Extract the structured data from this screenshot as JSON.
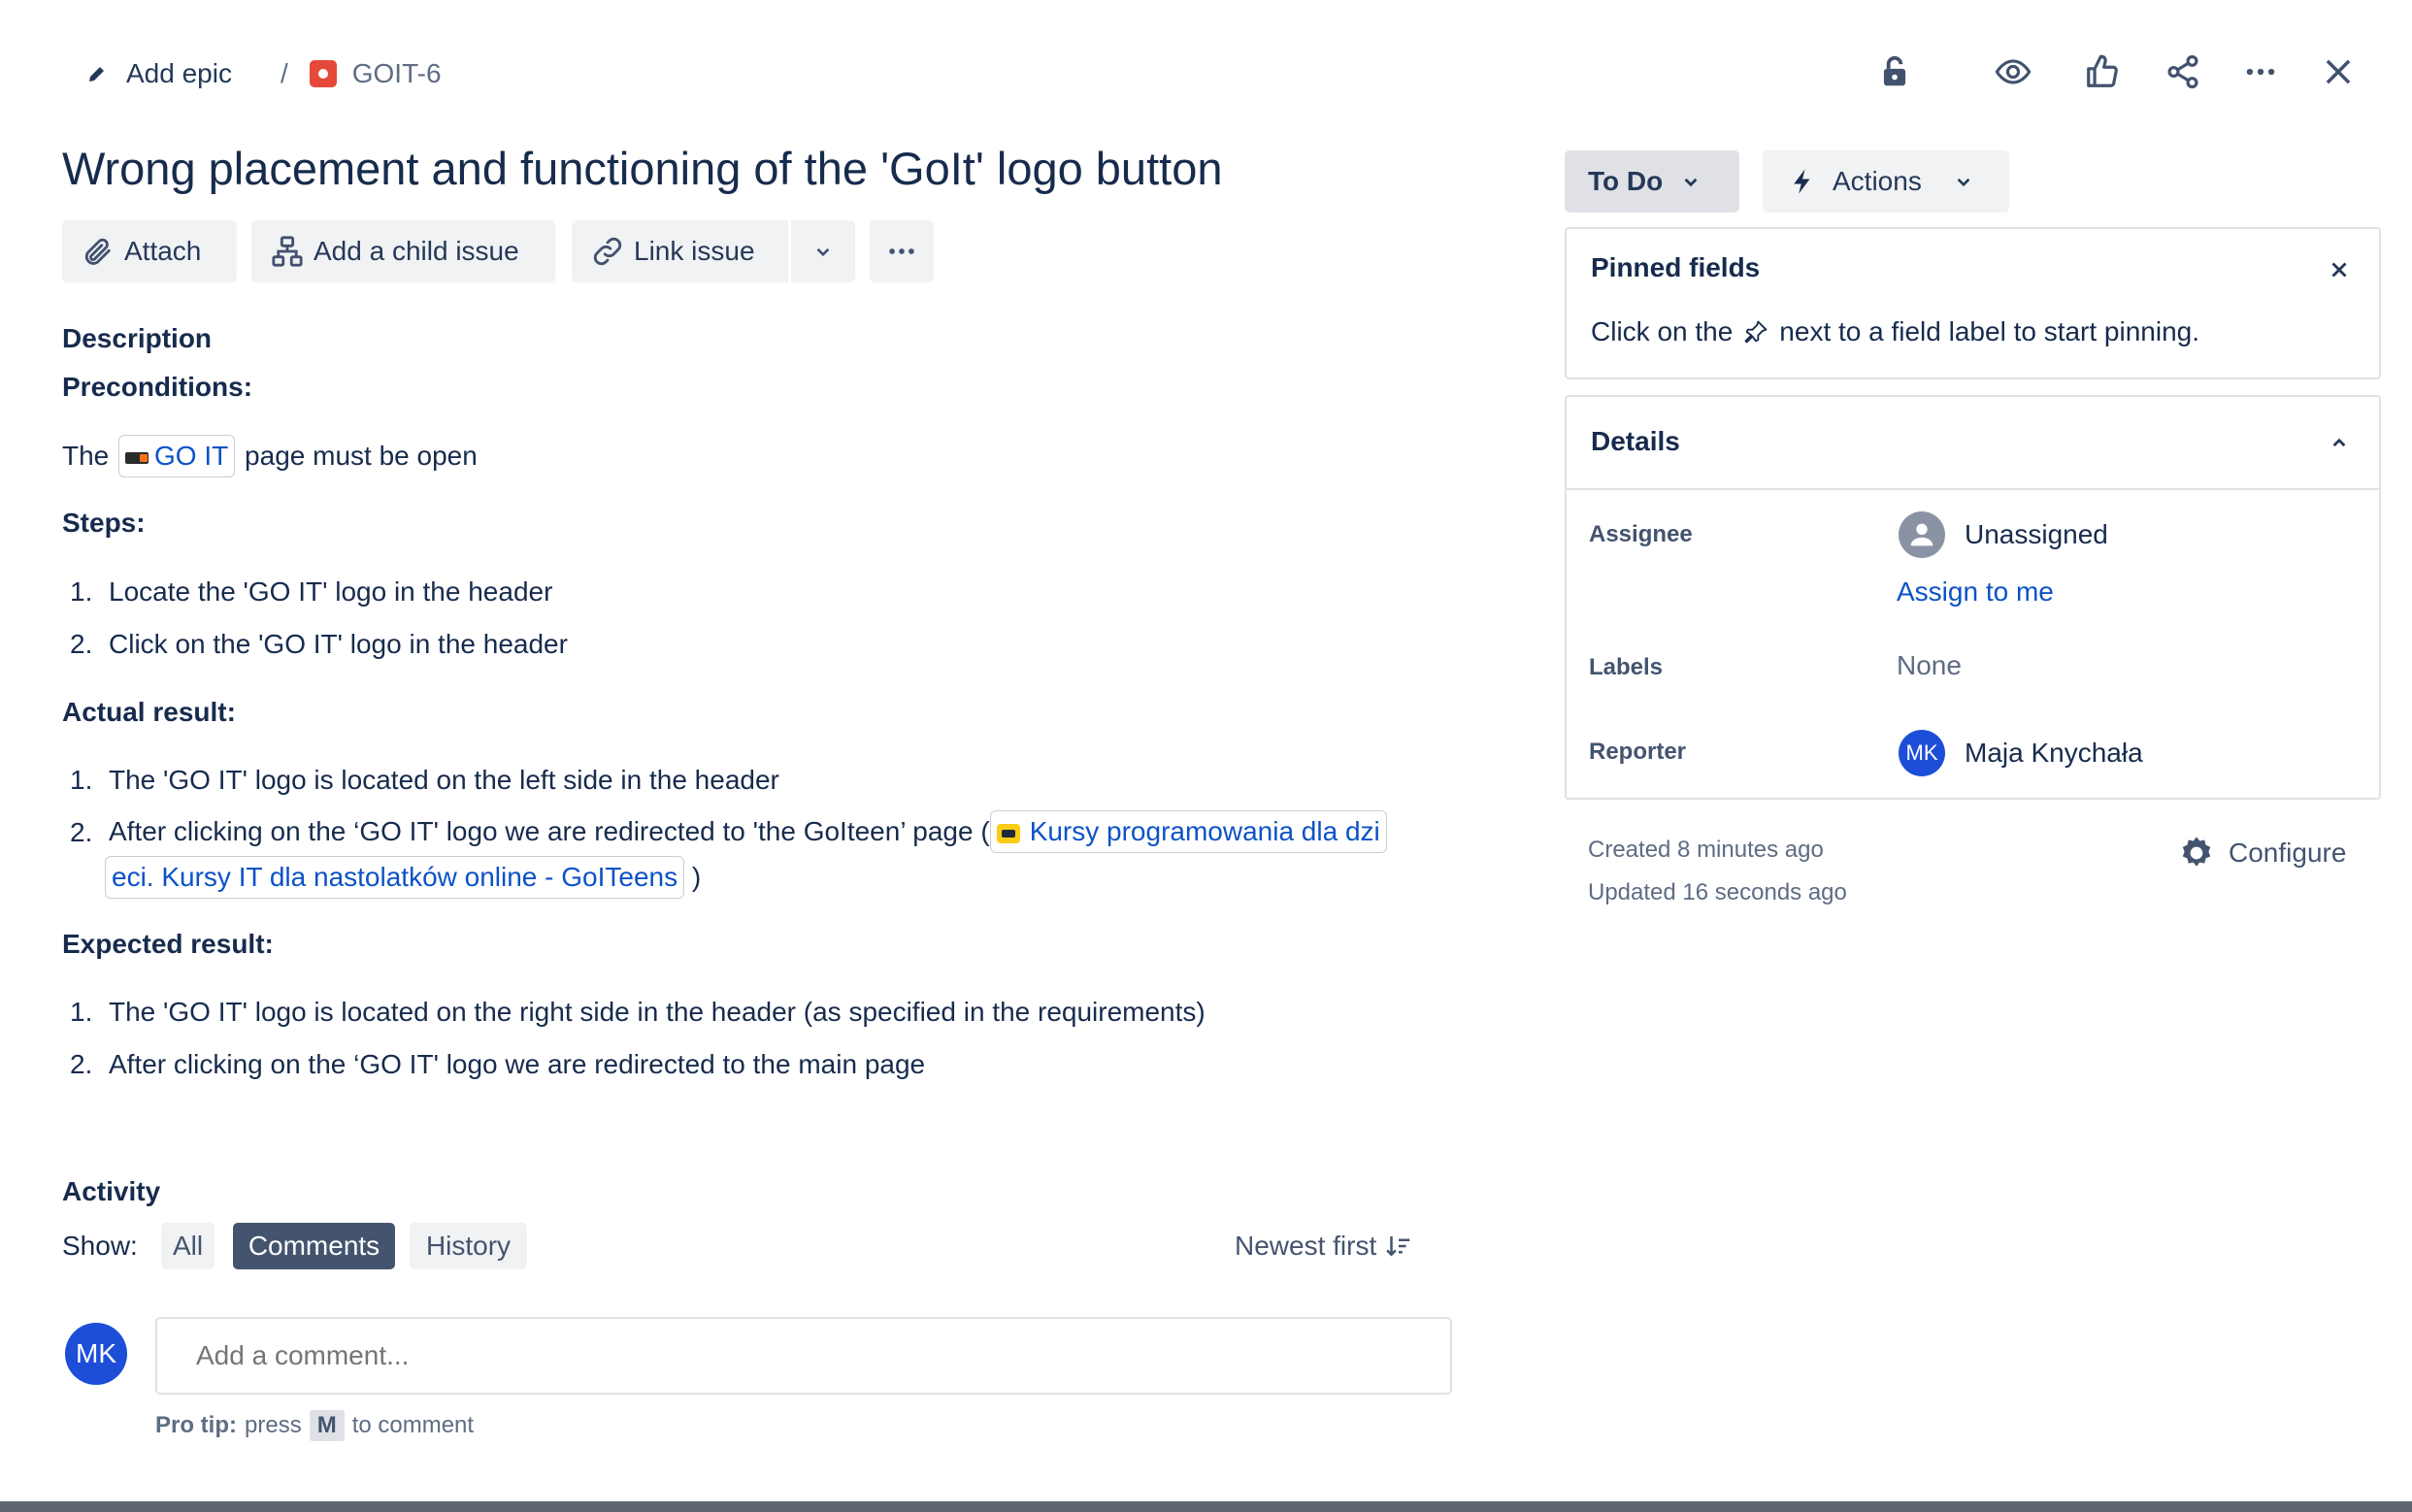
{
  "breadcrumb": {
    "add_epic": "Add epic",
    "separator": "/",
    "issue_key": "GOIT-6"
  },
  "title": "Wrong placement and functioning of the 'GoIt' logo button",
  "toolbar": {
    "attach": "Attach",
    "add_child": "Add a child issue",
    "link_issue": "Link issue"
  },
  "status": {
    "label": "To Do",
    "actions": "Actions"
  },
  "description": {
    "heading": "Description",
    "preconditions_heading": "Preconditions:",
    "pre_text_before": "The",
    "pre_link": "GO IT",
    "pre_text_after": "page must be open",
    "steps_heading": "Steps:",
    "steps": [
      {
        "num": "1.",
        "text": "Locate the  'GO IT' logo in the header"
      },
      {
        "num": "2.",
        "text": "Click on the 'GO IT' logo in the header"
      }
    ],
    "actual_heading": "Actual result:",
    "actual": [
      {
        "num": "1.",
        "text": "The 'GO IT' logo is located on the left side in the header"
      },
      {
        "num": "2.",
        "text": "After clicking on the ‘GO IT' logo we are redirected to 'the GoIteen’ page ("
      }
    ],
    "actual_link_line1": "Kursy programowania dla dzi",
    "actual_link_line2": "eci. Kursy IT dla nastolatków online - GoITeens",
    "actual_close": ")",
    "expected_heading": "Expected result:",
    "expected": [
      {
        "num": "1.",
        "text": "The 'GO IT' logo is located on the right side in the header (as specified in the requirements)"
      },
      {
        "num": "2.",
        "text": "After clicking on the ‘GO IT' logo we are redirected to the main page"
      }
    ]
  },
  "activity": {
    "heading": "Activity",
    "show_label": "Show:",
    "filters": [
      "All",
      "Comments",
      "History"
    ],
    "active_filter": "Comments",
    "sort": "Newest first",
    "avatar_initials": "MK",
    "comment_placeholder": "Add a comment...",
    "pro_tip_label": "Pro tip:",
    "pro_tip_press": "press",
    "pro_tip_key": "M",
    "pro_tip_after": "to comment"
  },
  "pinned": {
    "title": "Pinned fields",
    "text_before": "Click on the",
    "text_after": "next to a field label to start pinning."
  },
  "details": {
    "title": "Details",
    "assignee_label": "Assignee",
    "assignee_value": "Unassigned",
    "assign_to_me": "Assign to me",
    "labels_label": "Labels",
    "labels_value": "None",
    "reporter_label": "Reporter",
    "reporter_initials": "MK",
    "reporter_name": "Maja Knychała"
  },
  "meta": {
    "created": "Created 8 minutes ago",
    "updated": "Updated 16 seconds ago",
    "configure": "Configure"
  },
  "colors": {
    "accent": "#0c52c7",
    "avatar": "#1d4ed8",
    "text": "#172b4d",
    "subtle": "#44546f"
  }
}
